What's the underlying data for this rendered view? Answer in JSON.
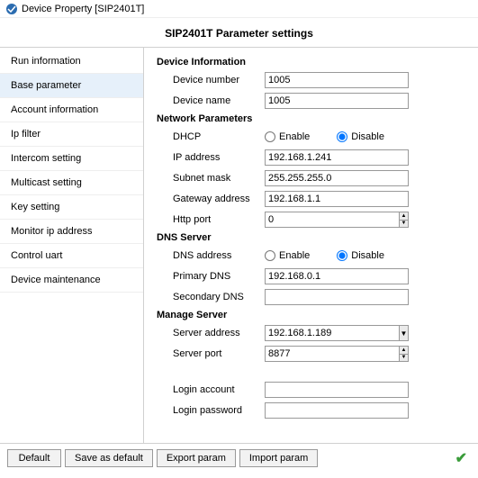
{
  "window": {
    "title": "Device Property [SIP2401T]",
    "heading": "SIP2401T Parameter settings"
  },
  "sidebar": {
    "items": [
      {
        "label": "Run information"
      },
      {
        "label": "Base parameter"
      },
      {
        "label": "Account information"
      },
      {
        "label": "Ip filter"
      },
      {
        "label": "Intercom setting"
      },
      {
        "label": "Multicast setting"
      },
      {
        "label": "Key setting"
      },
      {
        "label": "Monitor ip address"
      },
      {
        "label": "Control uart"
      },
      {
        "label": "Device maintenance"
      }
    ],
    "active_index": 1
  },
  "sections": {
    "device_info": {
      "header": "Device Information",
      "device_number_label": "Device number",
      "device_number_value": "1005",
      "device_name_label": "Device name",
      "device_name_value": "1005"
    },
    "network": {
      "header": "Network Parameters",
      "dhcp_label": "DHCP",
      "enable_label": "Enable",
      "disable_label": "Disable",
      "dhcp_selected": "disable",
      "ip_label": "IP address",
      "ip_value": "192.168.1.241",
      "subnet_label": "Subnet mask",
      "subnet_value": "255.255.255.0",
      "gateway_label": "Gateway address",
      "gateway_value": "192.168.1.1",
      "http_port_label": "Http port",
      "http_port_value": "0"
    },
    "dns": {
      "header": "DNS Server",
      "dns_addr_label": "DNS address",
      "enable_label": "Enable",
      "disable_label": "Disable",
      "dns_selected": "disable",
      "primary_label": "Primary DNS",
      "primary_value": "192.168.0.1",
      "secondary_label": "Secondary DNS",
      "secondary_value": ""
    },
    "manage": {
      "header": "Manage Server",
      "server_addr_label": "Server address",
      "server_addr_value": "192.168.1.189",
      "server_port_label": "Server port",
      "server_port_value": "8877",
      "login_acct_label": "Login account",
      "login_acct_value": "",
      "login_pwd_label": "Login password",
      "login_pwd_value": ""
    }
  },
  "footer": {
    "default": "Default",
    "save_default": "Save as default",
    "export": "Export param",
    "import": "Import param"
  }
}
